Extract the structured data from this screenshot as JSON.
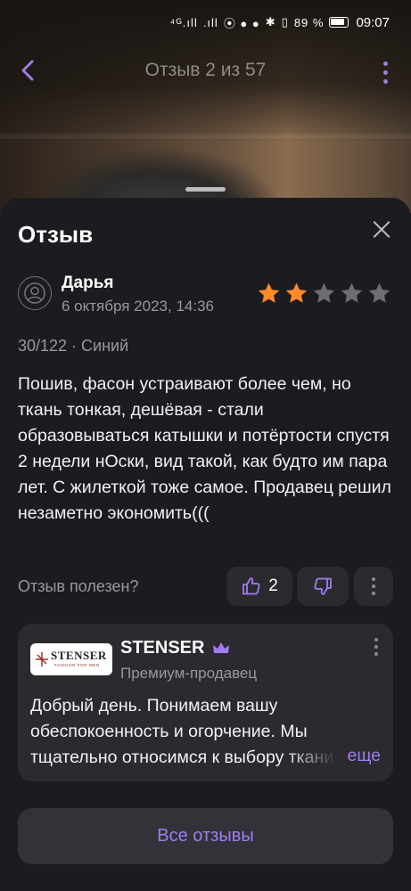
{
  "status_bar": {
    "network": "⁴ᴳ.ıll",
    "signal2": ".ıll",
    "battery_percent": "89 %",
    "time": "09:07"
  },
  "header": {
    "title": "Отзыв 2 из 57"
  },
  "sheet": {
    "title": "Отзыв"
  },
  "review": {
    "author": "Дарья",
    "date": "6 октября 2023, 14:36",
    "rating": 2,
    "rating_max": 5,
    "meta": "30/122 · Синий",
    "text": "Пошив, фасон устраивают более чем, но ткань тонкая, дешёвая - стали образовываться катышки  и потёртости спустя 2 недели нОски, вид такой, как будто им пара лет. С жилеткой тоже самое. Продавец решил незаметно экономить((("
  },
  "helpful": {
    "label": "Отзыв полезен?",
    "likes": "2"
  },
  "seller_reply": {
    "logo_word": "STENSER",
    "logo_tagline": "FASHION FOR MEN",
    "name": "STENSER",
    "subtitle": "Премиум-продавец",
    "text": "Добрый день. Понимаем вашу обеспокоенность и огорчение. Мы тщательно относимся к выбору ткани",
    "more_label": "еще"
  },
  "all_reviews_label": "Все отзывы",
  "colors": {
    "accent": "#a27cf2",
    "star_active": "#ff8a2a",
    "star_inactive": "#6f6c74",
    "background": "#1c1b1f",
    "card": "#2b2a2f"
  }
}
